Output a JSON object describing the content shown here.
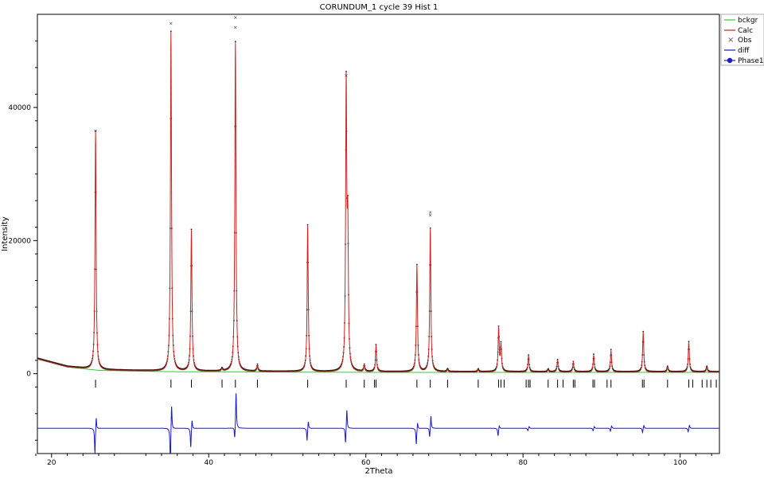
{
  "chart_data": {
    "type": "line",
    "title": "CORUNDUM_1 cycle 39 Hist 1",
    "xlabel": "2Theta",
    "ylabel": "Intensity",
    "xlim": [
      18.2,
      105
    ],
    "ylim": [
      -12000,
      54000
    ],
    "x_ticks": [
      20,
      40,
      60,
      80,
      100
    ],
    "y_ticks": [
      0,
      20000,
      40000
    ],
    "legend_position": "top-right",
    "legend": [
      {
        "name": "bckgr",
        "color": "#33cc33",
        "marker": "line"
      },
      {
        "name": "Calc",
        "color": "#cc2222",
        "marker": "line"
      },
      {
        "name": "Obs",
        "color": "#555555",
        "marker": "x"
      },
      {
        "name": "diff",
        "color": "#1a1acc",
        "marker": "line"
      },
      {
        "name": "Phase1",
        "color": "#1a1acc",
        "marker": "dot-line"
      }
    ],
    "background": {
      "points": [
        [
          18.2,
          2200
        ],
        [
          22,
          1000
        ],
        [
          26,
          500
        ],
        [
          35,
          300
        ],
        [
          60,
          200
        ],
        [
          105,
          200
        ]
      ]
    },
    "peaks": [
      {
        "x": 25.6,
        "h": 35800,
        "w": 0.085
      },
      {
        "x": 35.2,
        "h": 51000,
        "w": 0.085
      },
      {
        "x": 37.8,
        "h": 21200,
        "w": 0.085
      },
      {
        "x": 41.7,
        "h": 400,
        "w": 0.085
      },
      {
        "x": 43.4,
        "h": 49500,
        "w": 0.085
      },
      {
        "x": 46.2,
        "h": 1000,
        "w": 0.085
      },
      {
        "x": 52.6,
        "h": 22000,
        "w": 0.085
      },
      {
        "x": 57.5,
        "h": 42000,
        "w": 0.085
      },
      {
        "x": 57.7,
        "h": 20000,
        "w": 0.085
      },
      {
        "x": 59.8,
        "h": 1000,
        "w": 0.085
      },
      {
        "x": 61.3,
        "h": 4000,
        "w": 0.085
      },
      {
        "x": 66.5,
        "h": 16000,
        "w": 0.085
      },
      {
        "x": 68.2,
        "h": 21500,
        "w": 0.085
      },
      {
        "x": 70.4,
        "h": 400,
        "w": 0.085
      },
      {
        "x": 74.3,
        "h": 400,
        "w": 0.085
      },
      {
        "x": 76.9,
        "h": 6500,
        "w": 0.085
      },
      {
        "x": 77.2,
        "h": 4000,
        "w": 0.085
      },
      {
        "x": 80.7,
        "h": 2500,
        "w": 0.085
      },
      {
        "x": 83.2,
        "h": 400,
        "w": 0.085
      },
      {
        "x": 84.4,
        "h": 1800,
        "w": 0.085
      },
      {
        "x": 86.4,
        "h": 1500,
        "w": 0.085
      },
      {
        "x": 89.0,
        "h": 2600,
        "w": 0.085
      },
      {
        "x": 91.2,
        "h": 3300,
        "w": 0.085
      },
      {
        "x": 95.3,
        "h": 6000,
        "w": 0.085
      },
      {
        "x": 98.4,
        "h": 800,
        "w": 0.085
      },
      {
        "x": 101.1,
        "h": 4500,
        "w": 0.085
      },
      {
        "x": 103.4,
        "h": 800,
        "w": 0.085
      }
    ],
    "obs_outliers": [
      {
        "x": 35.2,
        "y": 52600
      },
      {
        "x": 43.4,
        "y": 53500
      },
      {
        "x": 43.4,
        "y": 52000
      },
      {
        "x": 57.5,
        "y": 44800
      },
      {
        "x": 68.2,
        "y": 24200
      },
      {
        "x": 68.2,
        "y": 23800
      },
      {
        "x": 25.6,
        "y": 36500
      }
    ],
    "reflection_ticks": [
      25.6,
      35.2,
      37.8,
      41.7,
      43.4,
      46.2,
      52.6,
      57.5,
      59.8,
      61.1,
      61.3,
      66.5,
      68.2,
      70.4,
      74.3,
      76.9,
      77.2,
      77.6,
      80.4,
      80.7,
      80.9,
      83.2,
      84.4,
      85.1,
      86.4,
      86.6,
      88.9,
      89.1,
      90.7,
      91.2,
      95.2,
      95.4,
      98.4,
      101.1,
      101.6,
      102.8,
      103.4,
      103.9,
      104.6
    ],
    "tick_row_y": -1500,
    "diff_baseline": -8200,
    "diff_spikes": [
      {
        "x": 25.6,
        "a": -4000,
        "b": 2000
      },
      {
        "x": 35.2,
        "a": -6000,
        "b": 4000
      },
      {
        "x": 37.8,
        "a": -3000,
        "b": 1500
      },
      {
        "x": 43.4,
        "a": -2000,
        "b": 5500
      },
      {
        "x": 52.6,
        "a": -2000,
        "b": 1200
      },
      {
        "x": 57.5,
        "a": -2500,
        "b": 3000
      },
      {
        "x": 66.5,
        "a": -2500,
        "b": 1000
      },
      {
        "x": 68.2,
        "a": -1500,
        "b": 2000
      },
      {
        "x": 76.9,
        "a": -1200,
        "b": 500
      },
      {
        "x": 80.7,
        "a": -400,
        "b": 300
      },
      {
        "x": 89.0,
        "a": -400,
        "b": 300
      },
      {
        "x": 91.2,
        "a": -500,
        "b": 400
      },
      {
        "x": 95.3,
        "a": -700,
        "b": 500
      },
      {
        "x": 101.1,
        "a": -600,
        "b": 500
      }
    ]
  }
}
